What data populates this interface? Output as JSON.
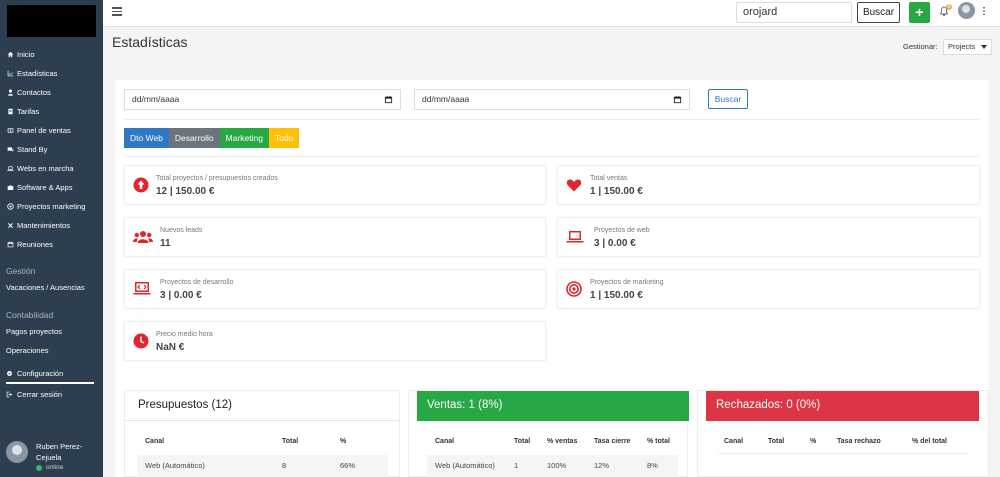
{
  "sidebar": {
    "items": [
      {
        "label": "Inicio",
        "icon": "home-icon"
      },
      {
        "label": "Estadísticas",
        "icon": "chart-icon"
      },
      {
        "label": "Contactos",
        "icon": "user-icon"
      },
      {
        "label": "Tarifas",
        "icon": "document-icon"
      },
      {
        "label": "Panel de ventas",
        "icon": "panel-icon"
      },
      {
        "label": "Stand By",
        "icon": "chat-icon"
      },
      {
        "label": "Webs en marcha",
        "icon": "laptop-icon"
      },
      {
        "label": "Software & Apps",
        "icon": "briefcase-icon"
      },
      {
        "label": "Proyectos marketing",
        "icon": "target-icon"
      },
      {
        "label": "Mantenimientos",
        "icon": "tools-icon"
      },
      {
        "label": "Reuniones",
        "icon": "calendar-icon"
      }
    ],
    "section_gestion": "Gestión",
    "vacaciones": "Vacaciones / Ausencias",
    "section_contabilidad": "Contabilidad",
    "pagos": "Pagos proyectos",
    "operaciones": "Operaciones",
    "configuracion": "Configuración",
    "cerrar": "Cerrar sesión",
    "user_name_1": "Ruben Perez-",
    "user_name_2": "Cejuela",
    "user_status": "online"
  },
  "topbar": {
    "search_value": "orojard",
    "buscar": "Buscar",
    "plus": "+",
    "bell_badge": "0"
  },
  "header": {
    "title": "Estadísticas",
    "gestionar": "Gestionar:",
    "projects": "Projects"
  },
  "filters": {
    "date_from": "dd/mm/aaaa",
    "date_to": "dd/mm/aaaa",
    "buscar": "Buscar"
  },
  "tabs": [
    {
      "label": "Dto Web",
      "color": "#2f78c4"
    },
    {
      "label": "Desarrollo",
      "color": "#6c757d"
    },
    {
      "label": "Marketing",
      "color": "#28a745"
    },
    {
      "label": "Todo",
      "color": "#ffc107"
    }
  ],
  "cards": {
    "total_proyectos_label": "Total proyectos / presupuestos creados",
    "total_proyectos_value": "12 | 150.00 €",
    "total_ventas_label": "Total ventas",
    "total_ventas_value": "1 | 150.00 €",
    "nuevos_leads_label": "Nuevos leads",
    "nuevos_leads_value": "11",
    "proy_web_label": "Proyectos de web",
    "proy_web_value": "3 | 0.00 €",
    "proy_desarrollo_label": "Proyectos de desarrollo",
    "proy_desarrollo_value": "3 | 0.00 €",
    "proy_marketing_label": "Proyectos de marketing",
    "proy_marketing_value": "1 | 150.00 €",
    "precio_label": "Precio medio hora",
    "precio_value": "NaN €",
    "icon_color": "#e0262b"
  },
  "presupuestos": {
    "title": "Presupuestos (12)",
    "headers": [
      "Canal",
      "Total",
      "%"
    ],
    "row": [
      "Web (Automático)",
      "8",
      "66%"
    ]
  },
  "ventas": {
    "title": "Ventas: 1 (8%)",
    "color": "#28a745",
    "headers": [
      "Canal",
      "Total",
      "% ventas",
      "Tasa cierre",
      "% total"
    ],
    "row": [
      "Web (Automático)",
      "1",
      "100%",
      "12%",
      "8%"
    ]
  },
  "rechazados": {
    "title": "Rechazados: 0 (0%)",
    "color": "#dc3545",
    "headers": [
      "Canal",
      "Total",
      "%",
      "Tasa rechazo",
      "% del total"
    ]
  }
}
